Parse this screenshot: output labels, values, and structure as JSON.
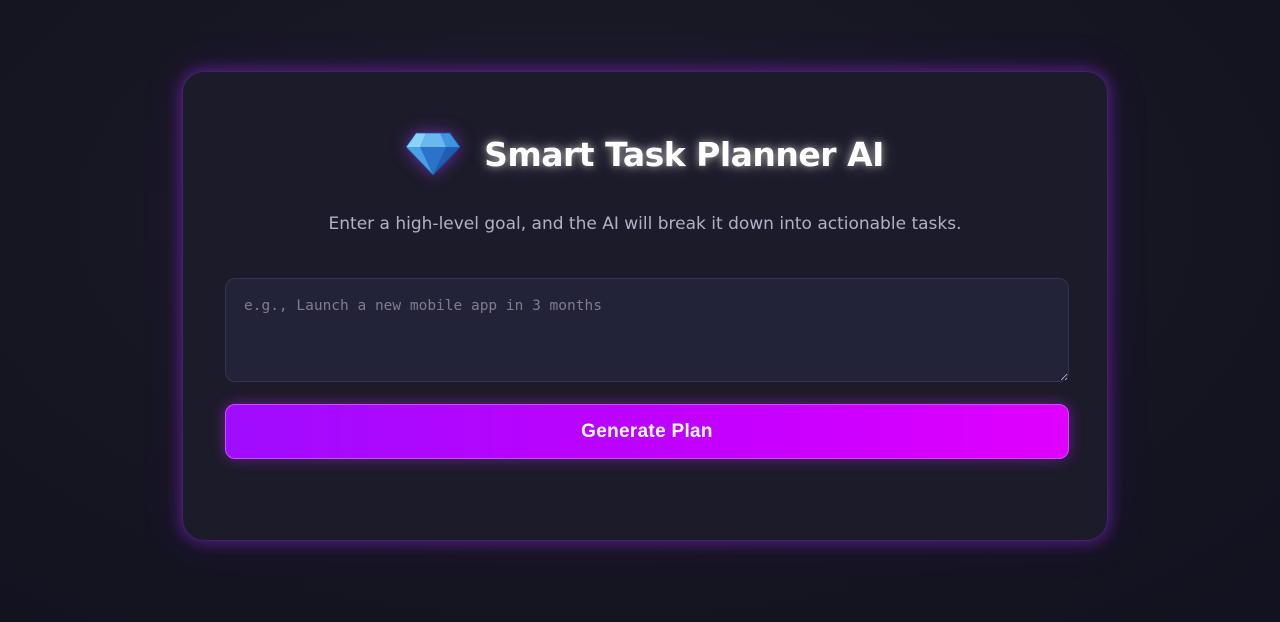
{
  "app": {
    "title": "Smart Task Planner AI",
    "subtitle": "Enter a high-level goal, and the AI will break it down into actionable tasks.",
    "logo_icon": "diamond-icon"
  },
  "goal_form": {
    "input_value": "",
    "input_placeholder": "e.g., Launch a new mobile app in 3 months",
    "submit_label": "Generate Plan"
  },
  "colors": {
    "background": "#161622",
    "card": "#1c1b29",
    "accent_start": "#9f0cff",
    "accent_end": "#e000ff",
    "subtitle_text": "#b3b0c6",
    "input_background": "#222239"
  }
}
